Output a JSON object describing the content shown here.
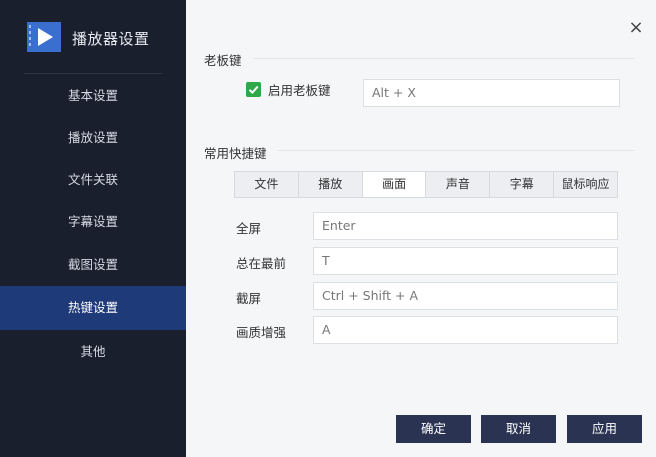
{
  "brand": {
    "title": "播放器设置",
    "logo_icon": "video-play-icon"
  },
  "sidebar": {
    "items": [
      {
        "label": "基本设置"
      },
      {
        "label": "播放设置"
      },
      {
        "label": "文件关联"
      },
      {
        "label": "字幕设置"
      },
      {
        "label": "截图设置"
      },
      {
        "label": "热键设置"
      },
      {
        "label": "其他"
      }
    ],
    "active_index": 5
  },
  "close_icon": "×",
  "boss_key": {
    "section_title": "老板键",
    "checkbox_label": "启用老板键",
    "checked": true,
    "value": "Alt + X"
  },
  "shortcuts": {
    "section_title": "常用快捷键",
    "tabs": [
      "文件",
      "播放",
      "画面",
      "声音",
      "字幕",
      "鼠标响应"
    ],
    "active_tab": 2,
    "rows": [
      {
        "label": "全屏",
        "value": "Enter"
      },
      {
        "label": "总在最前",
        "value": "T"
      },
      {
        "label": "截屏",
        "value": "Ctrl + Shift + A"
      },
      {
        "label": "画质增强",
        "value": "A"
      }
    ]
  },
  "buttons": {
    "ok": "确定",
    "cancel": "取消",
    "apply": "应用"
  },
  "colors": {
    "sidebar_bg": "#1a1f2e",
    "active_item_bg": "#1e3a78",
    "button_bg": "#2a3452",
    "checkbox_green": "#2fa84a"
  }
}
